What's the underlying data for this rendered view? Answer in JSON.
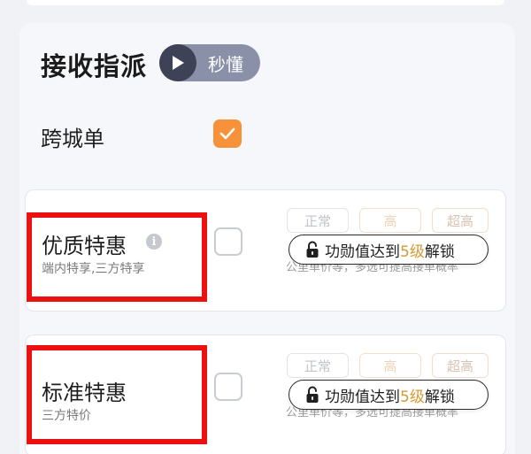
{
  "section": {
    "title": "接收指派",
    "quick_label": "秒懂"
  },
  "cross_city": {
    "label": "跨城单",
    "checked": true,
    "check_color": "#f7913a"
  },
  "cards": [
    {
      "name": "优质特惠",
      "description": "端内特享,三方特享",
      "has_info_icon": true,
      "checked": false,
      "levels": [
        "正常",
        "高",
        "超高"
      ],
      "faded_text": "公里单价等，多选可提高接单概率",
      "lock_prefix": "功勋值达到",
      "lock_level": "5级",
      "lock_suffix": "解锁"
    },
    {
      "name": "标准特惠",
      "description": "三方特价",
      "has_info_icon": false,
      "checked": false,
      "levels": [
        "正常",
        "高",
        "超高"
      ],
      "faded_text": "公里单价等，多选可提高接单概率",
      "lock_prefix": "功勋值达到",
      "lock_level": "5级",
      "lock_suffix": "解锁"
    }
  ],
  "icons": {
    "play": "play-icon",
    "check": "check-icon",
    "info": "info-icon",
    "lock": "unlock-icon"
  },
  "colors": {
    "highlight_box": "#ec1111",
    "level_gold": "#d49a34"
  }
}
